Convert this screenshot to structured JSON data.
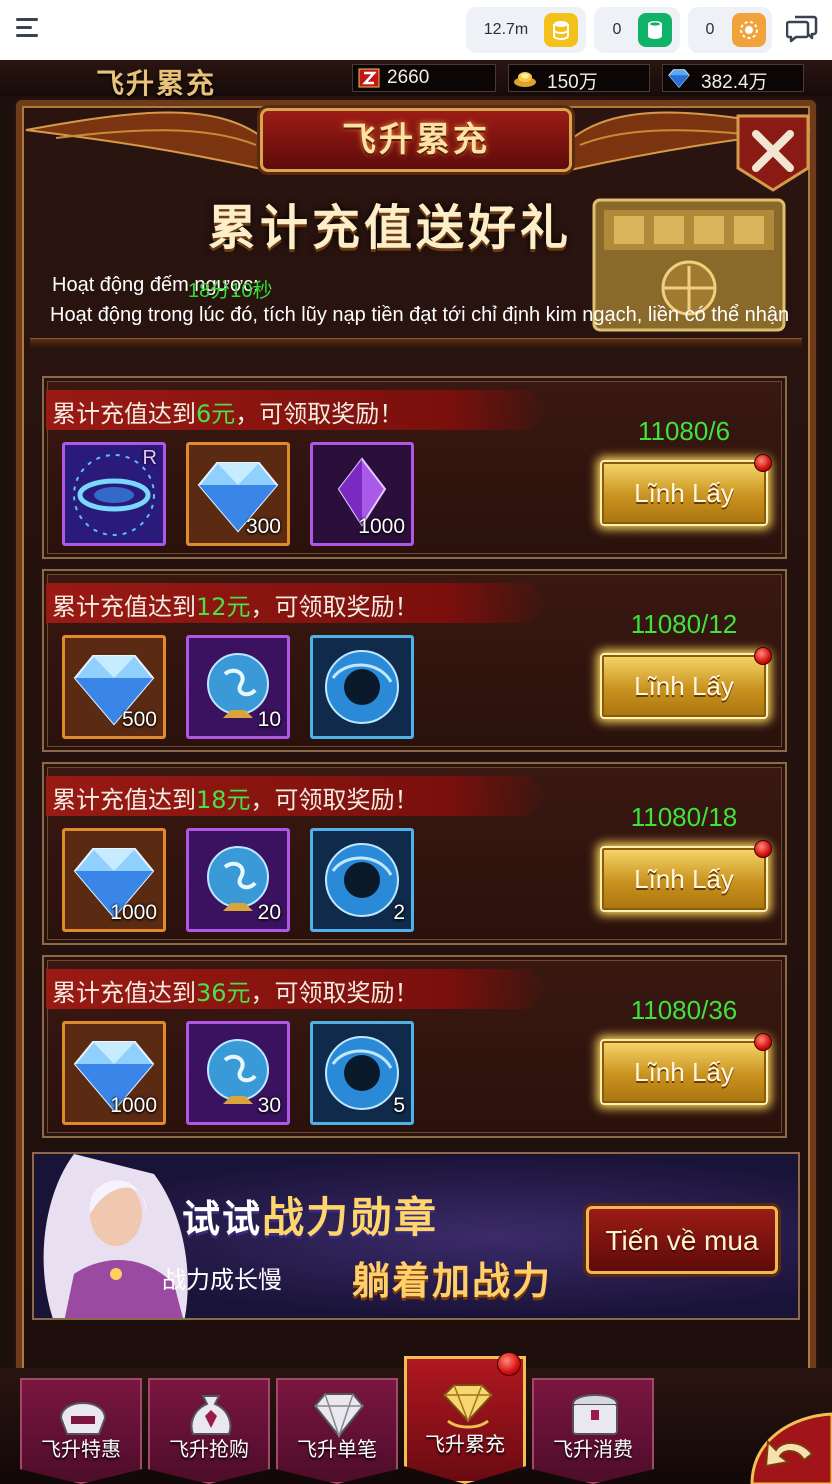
{
  "topbar": {
    "currency_1": {
      "value": "12.7m",
      "icon": "gold-coins-icon",
      "color": "#f2c21b"
    },
    "currency_2": {
      "value": "0",
      "icon": "green-cylinder-icon",
      "color": "#10b26a"
    },
    "currency_3": {
      "value": "0",
      "icon": "orange-flower-icon",
      "color": "#f2a23a"
    }
  },
  "resources": {
    "title": "飞升累充",
    "stamina": "2660",
    "gold": "150万",
    "diamonds": "382.4万"
  },
  "header": {
    "title": "飞升累充",
    "promo": "累计充值送好礼"
  },
  "info": {
    "countdown_label": "Hoạt động đếm ngược:",
    "countdown_value": "18分10秒",
    "description": "Hoạt động trong lúc đó, tích lũy nạp tiền đạt tới chỉ định kim ngạch, liền có thể nhận"
  },
  "rows": [
    {
      "prefix": "累计充值达到",
      "amount": "6元",
      "suffix": "，可领取奖励！",
      "progress": "11080/6",
      "button": "Lĩnh Lấy",
      "items": [
        {
          "icon": "rune-ring-icon",
          "qty": "",
          "rank": "R",
          "frame": "purple"
        },
        {
          "icon": "diamond-icon",
          "qty": "300",
          "rank": "",
          "frame": "orange"
        },
        {
          "icon": "purple-crystal-icon",
          "qty": "1000",
          "rank": "",
          "frame": "purple"
        }
      ]
    },
    {
      "prefix": "累计充值达到",
      "amount": "12元",
      "suffix": "，可领取奖励！",
      "progress": "11080/12",
      "button": "Lĩnh Lấy",
      "items": [
        {
          "icon": "diamond-icon",
          "qty": "500",
          "rank": "",
          "frame": "orange"
        },
        {
          "icon": "dragon-orb-icon",
          "qty": "10",
          "rank": "",
          "frame": "purple"
        },
        {
          "icon": "blue-orb-icon",
          "qty": "",
          "rank": "",
          "frame": "blue"
        }
      ]
    },
    {
      "prefix": "累计充值达到",
      "amount": "18元",
      "suffix": "，可领取奖励！",
      "progress": "11080/18",
      "button": "Lĩnh Lấy",
      "items": [
        {
          "icon": "diamond-icon",
          "qty": "1000",
          "rank": "",
          "frame": "orange"
        },
        {
          "icon": "dragon-orb-icon",
          "qty": "20",
          "rank": "",
          "frame": "purple"
        },
        {
          "icon": "blue-orb-icon",
          "qty": "2",
          "rank": "",
          "frame": "blue"
        }
      ]
    },
    {
      "prefix": "累计充值达到",
      "amount": "36元",
      "suffix": "，可领取奖励！",
      "progress": "11080/36",
      "button": "Lĩnh Lấy",
      "items": [
        {
          "icon": "diamond-icon",
          "qty": "1000",
          "rank": "",
          "frame": "orange"
        },
        {
          "icon": "dragon-orb-icon",
          "qty": "30",
          "rank": "",
          "frame": "purple"
        },
        {
          "icon": "blue-orb-icon",
          "qty": "5",
          "rank": "",
          "frame": "blue"
        }
      ]
    }
  ],
  "ad": {
    "line1_a": "试试",
    "line1_b": "战力勋章",
    "line2": "战力成长慢",
    "line3": "躺着加战力",
    "button": "Tiến về mua"
  },
  "tabs": [
    {
      "label": "飞升特惠",
      "icon": "helmet-icon"
    },
    {
      "label": "飞升抢购",
      "icon": "money-bag-icon"
    },
    {
      "label": "飞升单笔",
      "icon": "gem-icon"
    },
    {
      "label": "飞升累充",
      "icon": "gem-stack-icon",
      "active": true
    },
    {
      "label": "飞升消费",
      "icon": "treasure-chest-icon"
    }
  ]
}
